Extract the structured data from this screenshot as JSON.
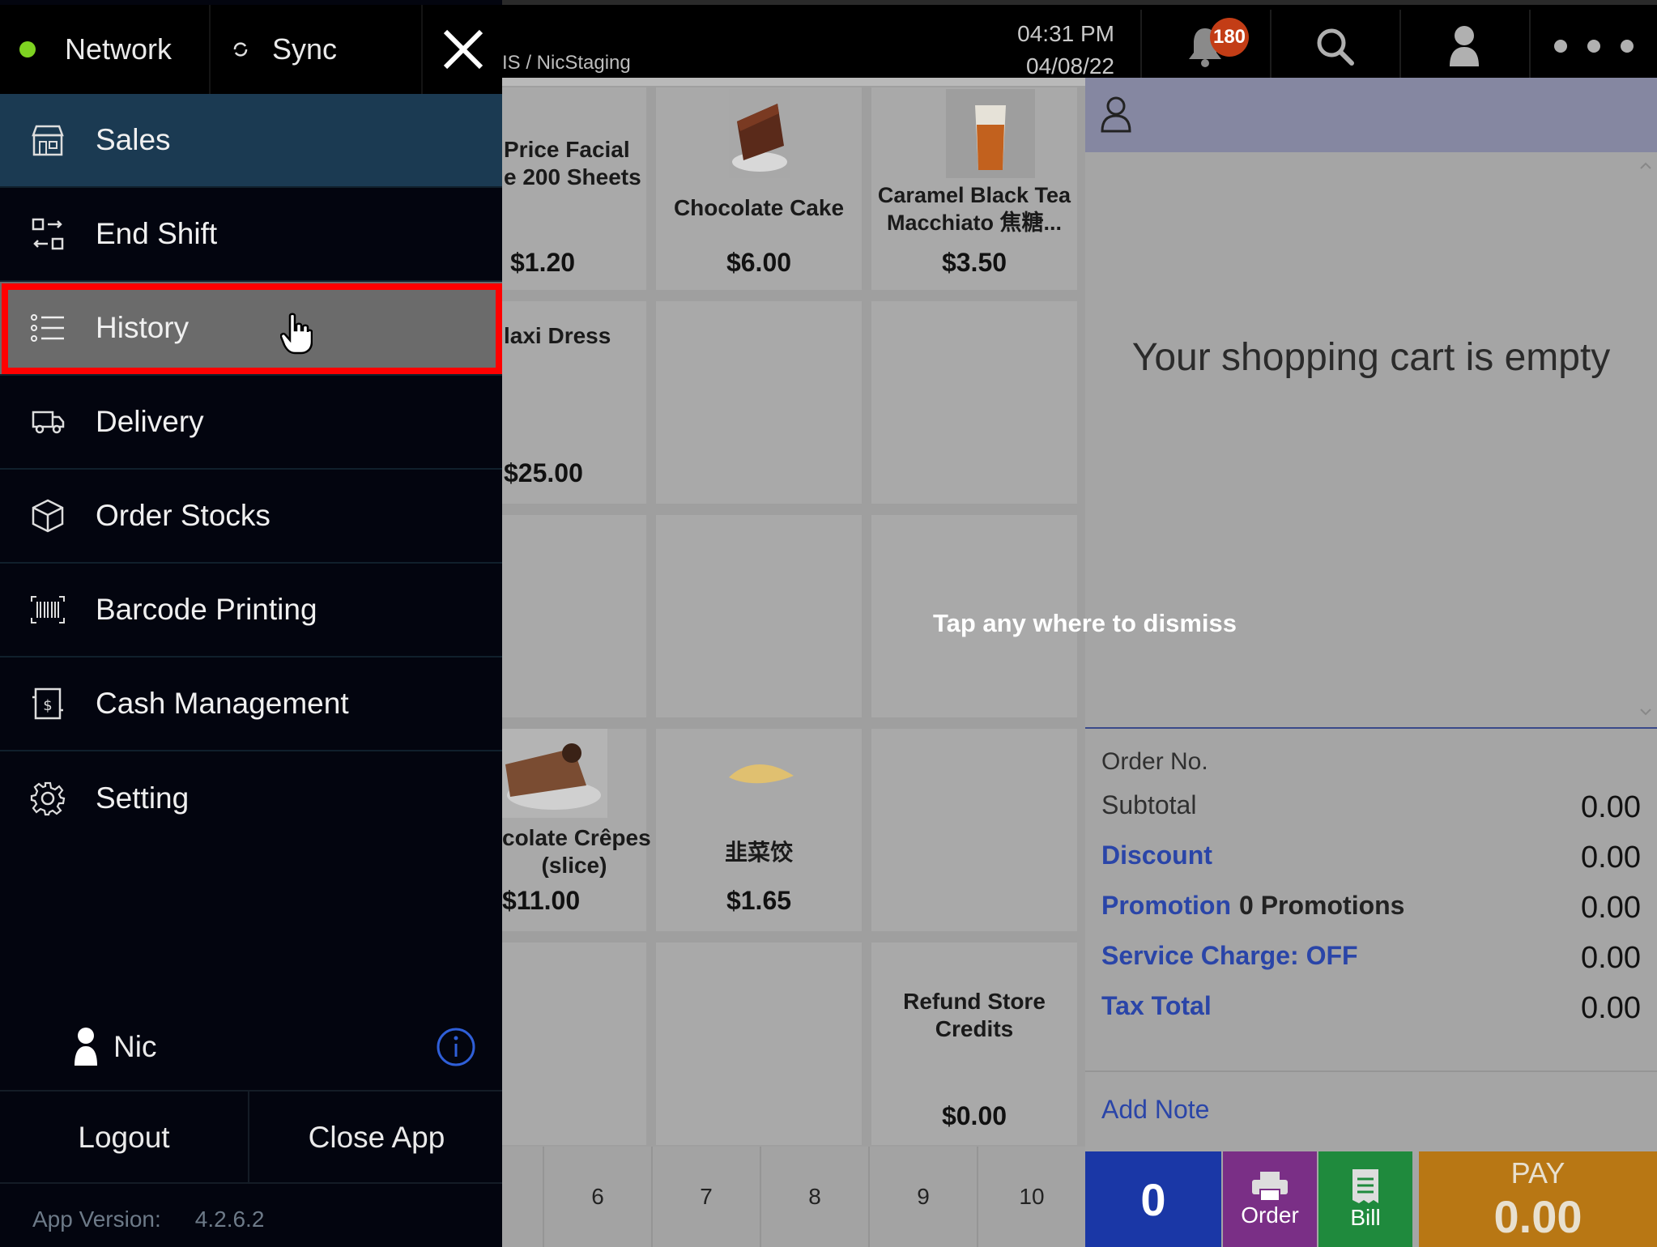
{
  "topbar": {
    "store_path": "IS / NicStaging",
    "time": "04:31 PM",
    "date": "04/08/22",
    "notification_count": "180"
  },
  "products": [
    {
      "name": "Price Facial\ne 200 Sheets",
      "price": "$1.20"
    },
    {
      "name": "Chocolate Cake",
      "price": "$6.00"
    },
    {
      "name": "Caramel Black Tea\nMacchiato 焦糖...",
      "price": "$3.50"
    },
    {
      "name": "laxi Dress",
      "price": "$25.00"
    },
    {
      "name": "colate Crêpes\n(slice)",
      "price": "$11.00"
    },
    {
      "name": "韭菜饺",
      "price": "$1.65"
    },
    {
      "name": "Refund Store\nCredits",
      "price": "$0.00"
    }
  ],
  "page_numbers": [
    "6",
    "7",
    "8",
    "9",
    "10"
  ],
  "cart": {
    "empty_message": "Your shopping cart is empty",
    "order_no_label": "Order No.",
    "subtotal_label": "Subtotal",
    "subtotal_value": "0.00",
    "discount_label": "Discount",
    "discount_value": "0.00",
    "promotion_label": "Promotion",
    "promotion_count": "0 Promotions",
    "promotion_value": "0.00",
    "service_charge_label": "Service Charge: OFF",
    "service_charge_value": "0.00",
    "tax_total_label": "Tax Total",
    "tax_total_value": "0.00",
    "add_note_label": "Add Note",
    "quantity": "0",
    "order_label": "Order",
    "bill_label": "Bill",
    "pay_label": "PAY",
    "pay_amount": "0.00"
  },
  "overlay": {
    "dismiss_text": "Tap any where to dismiss"
  },
  "drawer": {
    "network_label": "Network",
    "network_status_color": "#7ed321",
    "sync_label": "Sync",
    "menu_items": [
      {
        "label": "Sales",
        "icon": "store-icon"
      },
      {
        "label": "End Shift",
        "icon": "shift-icon"
      },
      {
        "label": "History",
        "icon": "list-icon"
      },
      {
        "label": "Delivery",
        "icon": "truck-icon"
      },
      {
        "label": "Order Stocks",
        "icon": "box-icon"
      },
      {
        "label": "Barcode Printing",
        "icon": "barcode-icon"
      },
      {
        "label": "Cash Management",
        "icon": "cash-icon"
      },
      {
        "label": "Setting",
        "icon": "gear-icon"
      }
    ],
    "user_name": "Nic",
    "logout_label": "Logout",
    "close_app_label": "Close App",
    "version_label": "App Version:",
    "version_value": "4.2.6.2"
  },
  "colors": {
    "highlight_box": "#ff0000",
    "active_item": "#1b3a52",
    "qty_button": "#1a37a6",
    "order_button": "#7a2f86",
    "bill_button": "#1f8a3d",
    "pay_button": "#b87714"
  }
}
